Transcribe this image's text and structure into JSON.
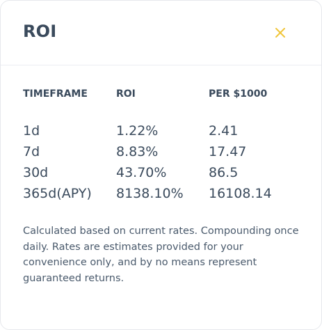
{
  "modal": {
    "title": "ROI",
    "close_icon": "close-icon",
    "accent_color": "#f0c53a"
  },
  "table": {
    "headers": [
      "TIMEFRAME",
      "ROI",
      "PER $1000"
    ],
    "rows": [
      {
        "timeframe": "1d",
        "roi": "1.22%",
        "per1000": "2.41"
      },
      {
        "timeframe": "7d",
        "roi": "8.83%",
        "per1000": "17.47"
      },
      {
        "timeframe": "30d",
        "roi": "43.70%",
        "per1000": "86.5"
      },
      {
        "timeframe": "365d(APY)",
        "roi": "8138.10%",
        "per1000": "16108.14"
      }
    ]
  },
  "footnote": "Calculated based on current rates. Compounding once daily. Rates are estimates provided for your convenience only, and by no means represent guaranteed returns."
}
